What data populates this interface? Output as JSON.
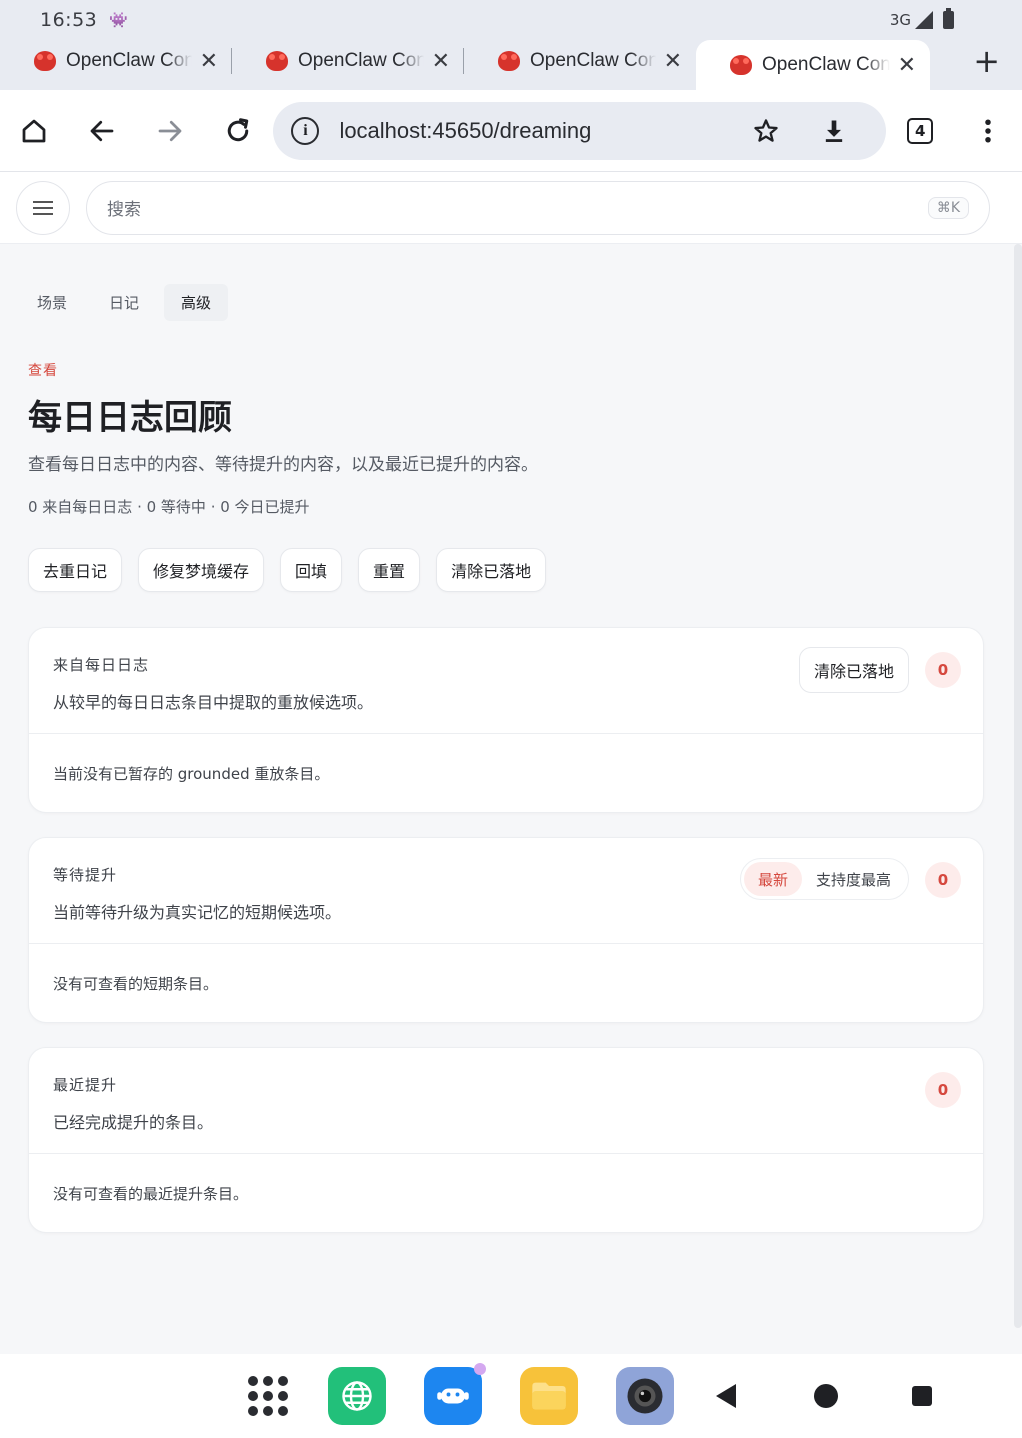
{
  "status_bar": {
    "time": "16:53",
    "network": "3G"
  },
  "browser": {
    "tabs": [
      {
        "title": "OpenClaw Control",
        "active": false
      },
      {
        "title": "OpenClaw Control",
        "active": false
      },
      {
        "title": "OpenClaw Control",
        "active": false
      },
      {
        "title": "OpenClaw Control",
        "active": true
      }
    ],
    "url": "localhost:45650/dreaming",
    "tab_count": "4"
  },
  "app_header": {
    "search_placeholder": "搜索",
    "search_shortcut": "⌘K"
  },
  "subtabs": [
    {
      "label": "场景",
      "active": false
    },
    {
      "label": "日记",
      "active": false
    },
    {
      "label": "高级",
      "active": true
    }
  ],
  "page": {
    "eyebrow": "查看",
    "title": "每日日志回顾",
    "description": "查看每日日志中的内容、等待提升的内容，以及最近已提升的内容。",
    "stats": "0 来自每日日志 · 0 等待中 · 0 今日已提升"
  },
  "actions": [
    "去重日记",
    "修复梦境缓存",
    "回填",
    "重置",
    "清除已落地"
  ],
  "cards": {
    "daily": {
      "title": "来自每日日志",
      "subtitle": "从较早的每日日志条目中提取的重放候选项。",
      "button": "清除已落地",
      "count": "0",
      "empty": "当前没有已暂存的 grounded 重放条目。"
    },
    "pending": {
      "title": "等待提升",
      "subtitle": "当前等待升级为真实记忆的短期候选项。",
      "sort_options": [
        "最新",
        "支持度最高"
      ],
      "sort_selected": "最新",
      "count": "0",
      "empty": "没有可查看的短期条目。"
    },
    "recent": {
      "title": "最近提升",
      "subtitle": "已经完成提升的条目。",
      "count": "0",
      "empty": "没有可查看的最近提升条目。"
    }
  },
  "colors": {
    "accent": "#d5483e",
    "accent_bg": "#fdeceb"
  }
}
